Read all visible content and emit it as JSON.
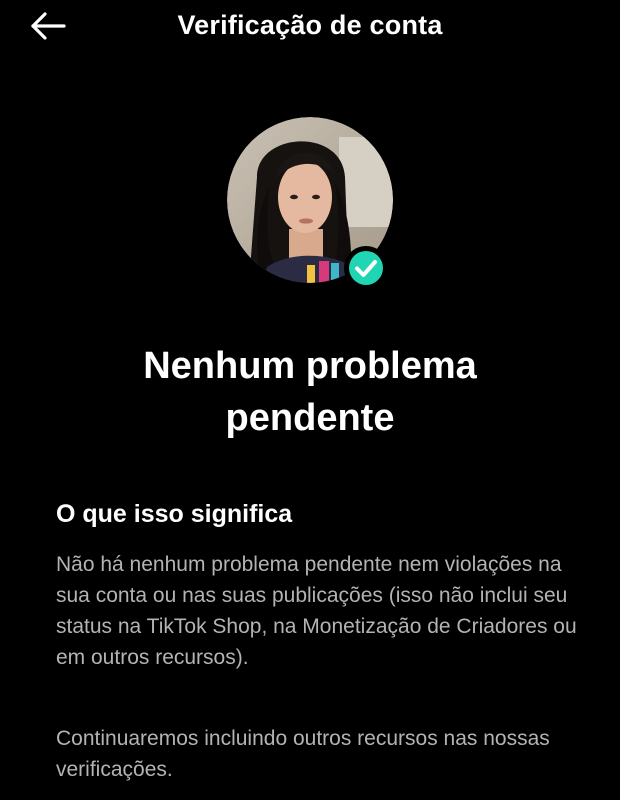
{
  "header": {
    "title": "Verificação de conta",
    "back_icon": "arrow-left-icon"
  },
  "profile": {
    "badge_icon": "check-icon",
    "badge_color": "#20d5b3"
  },
  "status": {
    "headline_line1": "Nenhum problema",
    "headline_line2": "pendente"
  },
  "info": {
    "title": "O que isso significa",
    "paragraph1": "Não há nenhum problema pendente nem violações na sua conta ou nas suas publicações (isso não inclui seu status na TikTok Shop, na Monetização de Criadores ou em outros recursos).",
    "paragraph2": "Continuaremos incluindo outros recursos nas nossas verificações."
  }
}
